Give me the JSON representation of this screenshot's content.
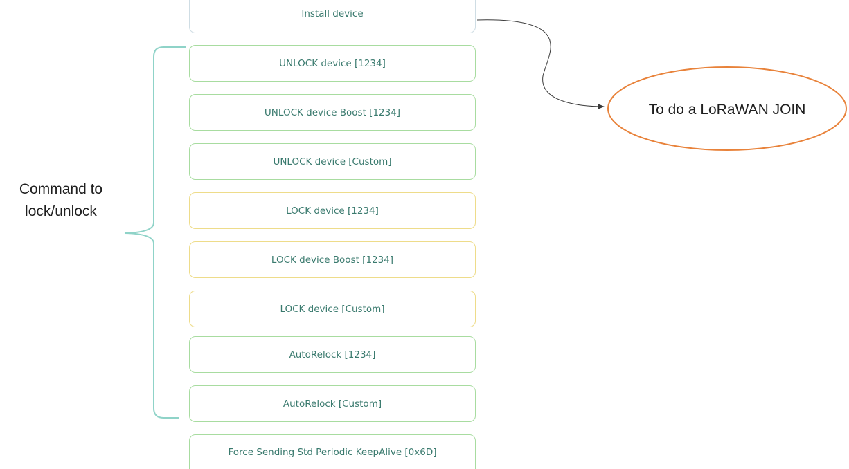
{
  "buttons": {
    "install": "Install device",
    "unlock": "UNLOCK device [1234]",
    "unlock_boost": "UNLOCK device Boost [1234]",
    "unlock_custom": "UNLOCK device [Custom]",
    "lock": "LOCK device [1234]",
    "lock_boost": "LOCK device Boost [1234]",
    "lock_custom": "LOCK device [Custom]",
    "autorelock": "AutoRelock [1234]",
    "autorelock_custom": "AutoRelock [Custom]",
    "force_keepalive": "Force Sending Std Periodic KeepAlive [0x6D]"
  },
  "annotations": {
    "lock_group_line1": "Command to",
    "lock_group_line2": "lock/unlock",
    "join_note": "To do a LoRaWAN JOIN"
  },
  "colors": {
    "unlock_border": "#a8dca0",
    "lock_border": "#eedc8a",
    "install_border": "#cfdde4",
    "button_text": "#3a7a6e",
    "brace": "#8fd3c8",
    "callout_ellipse": "#e8823a",
    "arrow": "#333333"
  }
}
